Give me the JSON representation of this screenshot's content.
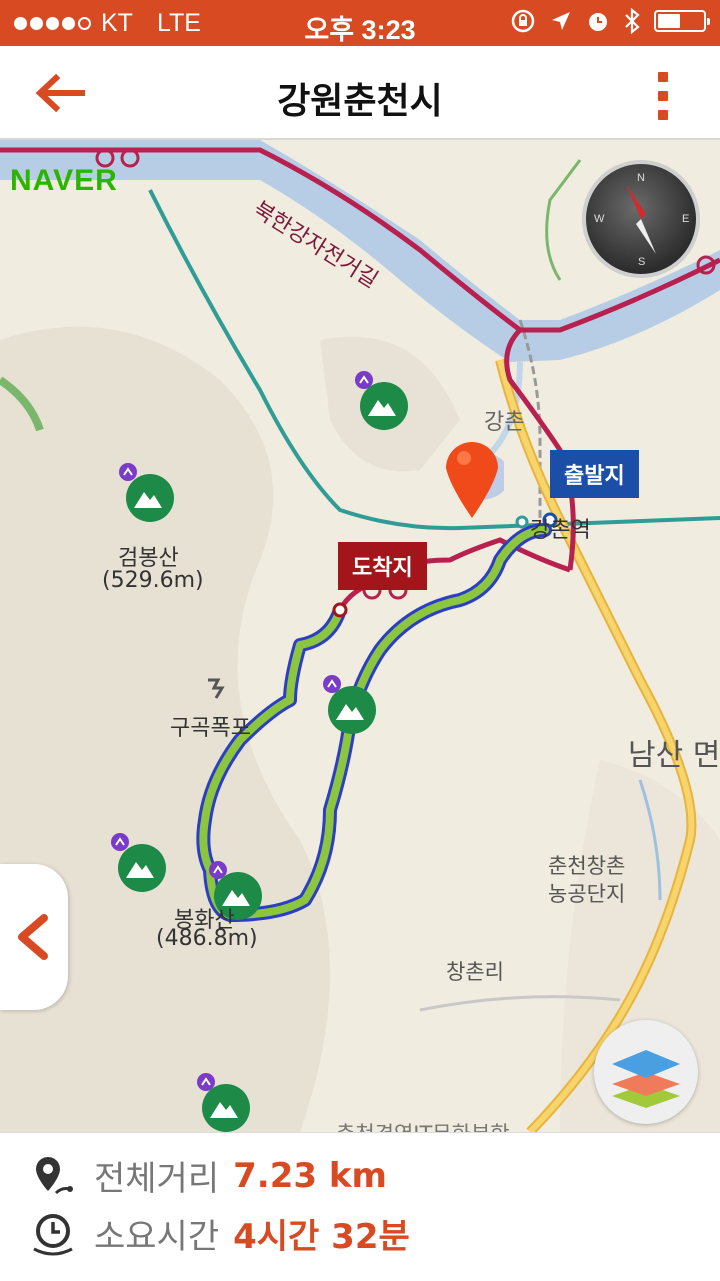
{
  "status_bar": {
    "carrier": "KT",
    "network": "LTE",
    "time": "오후 3:23"
  },
  "header": {
    "title": "강원춘천시"
  },
  "map": {
    "logo": "NAVER",
    "labels": {
      "river_trail": "북한강자전거길",
      "gangchon": "강촌",
      "station": "강촌역",
      "geombongsan": "검봉산",
      "geombongsan_height": "(529.6m)",
      "waterfall": "구곡폭포",
      "bonghwasan": "봉화산",
      "bonghwasan_height": "(486.8m)",
      "namsan": "남산 면",
      "industrial1": "춘천창촌",
      "industrial2": "농공단지",
      "changchon": "창촌리",
      "bottom_text": "춘천경영IT무화부학"
    },
    "start_label": "출발지",
    "end_label": "도착지",
    "compass": {
      "n": "N",
      "e": "E",
      "s": "S",
      "w": "W"
    }
  },
  "info": {
    "distance_label": "전체거리",
    "distance_value": "7.23 km",
    "time_label": "소요시간",
    "time_value": "4시간 32분"
  },
  "colors": {
    "accent": "#d84a22",
    "route_green": "#8cc63f",
    "route_blue": "#2c3ec4",
    "start_tag": "#1b4ea6",
    "end_tag": "#a3151b",
    "bike_path": "#b8204f",
    "road_yellow": "#f2c14e",
    "river": "#b7cde6"
  },
  "icons": [
    "back-arrow-icon",
    "more-vertical-icon",
    "compass-icon",
    "location-pin-icon",
    "mountain-icon",
    "waterfall-icon",
    "chevron-left-icon",
    "layers-icon",
    "distance-icon",
    "clock-icon",
    "battery-icon",
    "alarm-icon",
    "bluetooth-icon",
    "navigation-arrow-icon",
    "rotation-lock-icon"
  ]
}
